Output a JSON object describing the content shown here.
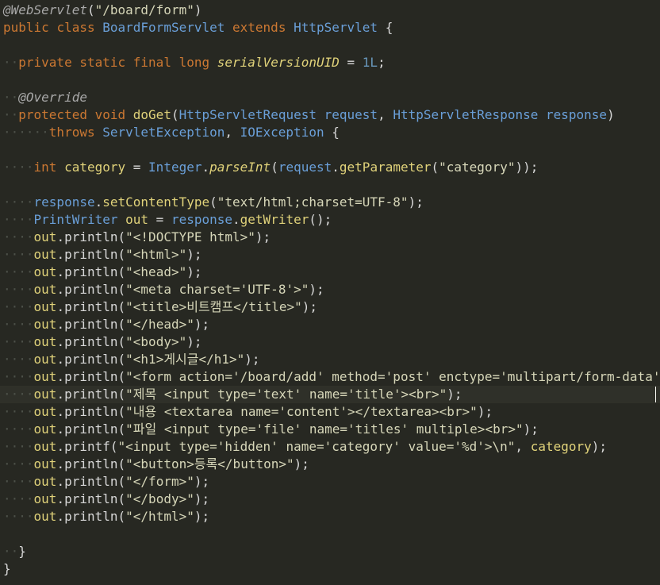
{
  "editor": {
    "colors": {
      "background": "#272822",
      "keyword": "#cc7832",
      "type": "#66d9ef",
      "string": "#e6db74",
      "method": "#a6e22e",
      "annotation": "#75715e",
      "number": "#ae81ff",
      "whitespace": "#4d5149"
    },
    "cursor_line": 22,
    "lines": [
      [
        [
          "ann",
          "@WebServlet"
        ],
        [
          "var",
          "("
        ],
        [
          "str",
          "\"/board/form\""
        ],
        [
          "var",
          ")"
        ]
      ],
      [
        [
          "kw2",
          "public"
        ],
        [
          "var",
          " "
        ],
        [
          "kw2",
          "class"
        ],
        [
          "var",
          " "
        ],
        [
          "typ",
          "BoardFormServlet"
        ],
        [
          "var",
          " "
        ],
        [
          "kw2",
          "extends"
        ],
        [
          "var",
          " "
        ],
        [
          "typ",
          "HttpServlet"
        ],
        [
          "var",
          " {"
        ]
      ],
      [],
      [
        [
          "ws",
          "··"
        ],
        [
          "kw2",
          "private"
        ],
        [
          "var",
          " "
        ],
        [
          "kw2",
          "static"
        ],
        [
          "var",
          " "
        ],
        [
          "kw2",
          "final"
        ],
        [
          "var",
          " "
        ],
        [
          "kw2",
          "long"
        ],
        [
          "var",
          " "
        ],
        [
          "fld",
          "serialVersionUID"
        ],
        [
          "var",
          " = "
        ],
        [
          "num",
          "1L"
        ],
        [
          "var",
          ";"
        ]
      ],
      [],
      [
        [
          "ws",
          "··"
        ],
        [
          "ann",
          "@Override"
        ]
      ],
      [
        [
          "ws",
          "··"
        ],
        [
          "kw2",
          "protected"
        ],
        [
          "var",
          " "
        ],
        [
          "kw2",
          "void"
        ],
        [
          "var",
          " "
        ],
        [
          "cls",
          "doGet"
        ],
        [
          "var",
          "("
        ],
        [
          "typ",
          "HttpServletRequest"
        ],
        [
          "var",
          " "
        ],
        [
          "typ",
          "request"
        ],
        [
          "var",
          ", "
        ],
        [
          "typ",
          "HttpServletResponse"
        ],
        [
          "var",
          " "
        ],
        [
          "typ",
          "response"
        ],
        [
          "var",
          ")"
        ]
      ],
      [
        [
          "ws",
          "······"
        ],
        [
          "kw2",
          "throws"
        ],
        [
          "var",
          " "
        ],
        [
          "typ",
          "ServletException"
        ],
        [
          "var",
          ", "
        ],
        [
          "typ",
          "IOException"
        ],
        [
          "var",
          " {"
        ]
      ],
      [],
      [
        [
          "ws",
          "····"
        ],
        [
          "kw2",
          "int"
        ],
        [
          "var",
          " "
        ],
        [
          "cls",
          "category"
        ],
        [
          "var",
          " = "
        ],
        [
          "typ",
          "Integer"
        ],
        [
          "var",
          "."
        ],
        [
          "fld",
          "parseInt"
        ],
        [
          "var",
          "("
        ],
        [
          "typ",
          "request"
        ],
        [
          "var",
          "."
        ],
        [
          "cls",
          "getParameter"
        ],
        [
          "var",
          "("
        ],
        [
          "str",
          "\"category\""
        ],
        [
          "var",
          "));"
        ]
      ],
      [],
      [
        [
          "ws",
          "····"
        ],
        [
          "typ",
          "response"
        ],
        [
          "var",
          "."
        ],
        [
          "cls",
          "setContentType"
        ],
        [
          "var",
          "("
        ],
        [
          "str",
          "\"text/html;charset=UTF-8\""
        ],
        [
          "var",
          ");"
        ]
      ],
      [
        [
          "ws",
          "····"
        ],
        [
          "typ",
          "PrintWriter"
        ],
        [
          "var",
          " "
        ],
        [
          "cls",
          "out"
        ],
        [
          "var",
          " = "
        ],
        [
          "typ",
          "response"
        ],
        [
          "var",
          "."
        ],
        [
          "cls",
          "getWriter"
        ],
        [
          "var",
          "();"
        ]
      ],
      [
        [
          "ws",
          "····"
        ],
        [
          "cls",
          "out"
        ],
        [
          "var",
          "."
        ],
        [
          "cls",
          "println"
        ],
        [
          "var",
          "("
        ],
        [
          "str",
          "\"<!DOCTYPE html>\""
        ],
        [
          "var",
          ");"
        ]
      ],
      [
        [
          "ws",
          "····"
        ],
        [
          "cls",
          "out"
        ],
        [
          "var",
          "."
        ],
        [
          "cls",
          "println"
        ],
        [
          "var",
          "("
        ],
        [
          "str",
          "\"<html>\""
        ],
        [
          "var",
          ");"
        ]
      ],
      [
        [
          "ws",
          "····"
        ],
        [
          "cls",
          "out"
        ],
        [
          "var",
          "."
        ],
        [
          "cls",
          "println"
        ],
        [
          "var",
          "("
        ],
        [
          "str",
          "\"<head>\""
        ],
        [
          "var",
          ");"
        ]
      ],
      [
        [
          "ws",
          "····"
        ],
        [
          "cls",
          "out"
        ],
        [
          "var",
          "."
        ],
        [
          "cls",
          "println"
        ],
        [
          "var",
          "("
        ],
        [
          "str",
          "\"<meta charset='UTF-8'>\""
        ],
        [
          "var",
          ");"
        ]
      ],
      [
        [
          "ws",
          "····"
        ],
        [
          "cls",
          "out"
        ],
        [
          "var",
          "."
        ],
        [
          "cls",
          "println"
        ],
        [
          "var",
          "("
        ],
        [
          "str",
          "\"<title>비트캠프</title>\""
        ],
        [
          "var",
          ");"
        ]
      ],
      [
        [
          "ws",
          "····"
        ],
        [
          "cls",
          "out"
        ],
        [
          "var",
          "."
        ],
        [
          "cls",
          "println"
        ],
        [
          "var",
          "("
        ],
        [
          "str",
          "\"</head>\""
        ],
        [
          "var",
          ");"
        ]
      ],
      [
        [
          "ws",
          "····"
        ],
        [
          "cls",
          "out"
        ],
        [
          "var",
          "."
        ],
        [
          "cls",
          "println"
        ],
        [
          "var",
          "("
        ],
        [
          "str",
          "\"<body>\""
        ],
        [
          "var",
          ");"
        ]
      ],
      [
        [
          "ws",
          "····"
        ],
        [
          "cls",
          "out"
        ],
        [
          "var",
          "."
        ],
        [
          "cls",
          "println"
        ],
        [
          "var",
          "("
        ],
        [
          "str",
          "\"<h1>게시글</h1>\""
        ],
        [
          "var",
          ");"
        ]
      ],
      [
        [
          "ws",
          "····"
        ],
        [
          "cls",
          "out"
        ],
        [
          "var",
          "."
        ],
        [
          "cls",
          "println"
        ],
        [
          "var",
          "("
        ],
        [
          "str",
          "\"<form action='/board/add' method='post' enctype='multipart/form-data'>\""
        ],
        [
          "var",
          ");"
        ]
      ],
      [
        [
          "ws",
          "····"
        ],
        [
          "cls",
          "out"
        ],
        [
          "var",
          "."
        ],
        [
          "cls",
          "println"
        ],
        [
          "var",
          "("
        ],
        [
          "str",
          "\"제목 <input type='text' name='title'><br>\""
        ],
        [
          "var",
          ");"
        ]
      ],
      [
        [
          "ws",
          "····"
        ],
        [
          "cls",
          "out"
        ],
        [
          "var",
          "."
        ],
        [
          "cls",
          "println"
        ],
        [
          "var",
          "("
        ],
        [
          "str",
          "\"내용 <textarea name='content'></textarea><br>\""
        ],
        [
          "var",
          ");"
        ]
      ],
      [
        [
          "ws",
          "····"
        ],
        [
          "cls",
          "out"
        ],
        [
          "var",
          "."
        ],
        [
          "cls",
          "println"
        ],
        [
          "var",
          "("
        ],
        [
          "str",
          "\"파일 <input type='file' name='titles' multiple><br>\""
        ],
        [
          "var",
          ");"
        ]
      ],
      [
        [
          "ws",
          "····"
        ],
        [
          "cls",
          "out"
        ],
        [
          "var",
          "."
        ],
        [
          "cls",
          "printf"
        ],
        [
          "var",
          "("
        ],
        [
          "str",
          "\"<input type='hidden' name='category' value='%d'>\\n\""
        ],
        [
          "var",
          ", "
        ],
        [
          "cls",
          "category"
        ],
        [
          "var",
          ");"
        ]
      ],
      [
        [
          "ws",
          "····"
        ],
        [
          "cls",
          "out"
        ],
        [
          "var",
          "."
        ],
        [
          "cls",
          "println"
        ],
        [
          "var",
          "("
        ],
        [
          "str",
          "\"<button>등록</button>\""
        ],
        [
          "var",
          ");"
        ]
      ],
      [
        [
          "ws",
          "····"
        ],
        [
          "cls",
          "out"
        ],
        [
          "var",
          "."
        ],
        [
          "cls",
          "println"
        ],
        [
          "var",
          "("
        ],
        [
          "str",
          "\"</form>\""
        ],
        [
          "var",
          ");"
        ]
      ],
      [
        [
          "ws",
          "····"
        ],
        [
          "cls",
          "out"
        ],
        [
          "var",
          "."
        ],
        [
          "cls",
          "println"
        ],
        [
          "var",
          "("
        ],
        [
          "str",
          "\"</body>\""
        ],
        [
          "var",
          ");"
        ]
      ],
      [
        [
          "ws",
          "····"
        ],
        [
          "cls",
          "out"
        ],
        [
          "var",
          "."
        ],
        [
          "cls",
          "println"
        ],
        [
          "var",
          "("
        ],
        [
          "str",
          "\"</html>\""
        ],
        [
          "var",
          ");"
        ]
      ],
      [],
      [
        [
          "ws",
          "··"
        ],
        [
          "var",
          "}"
        ]
      ],
      [
        [
          "var",
          "}"
        ]
      ]
    ]
  }
}
